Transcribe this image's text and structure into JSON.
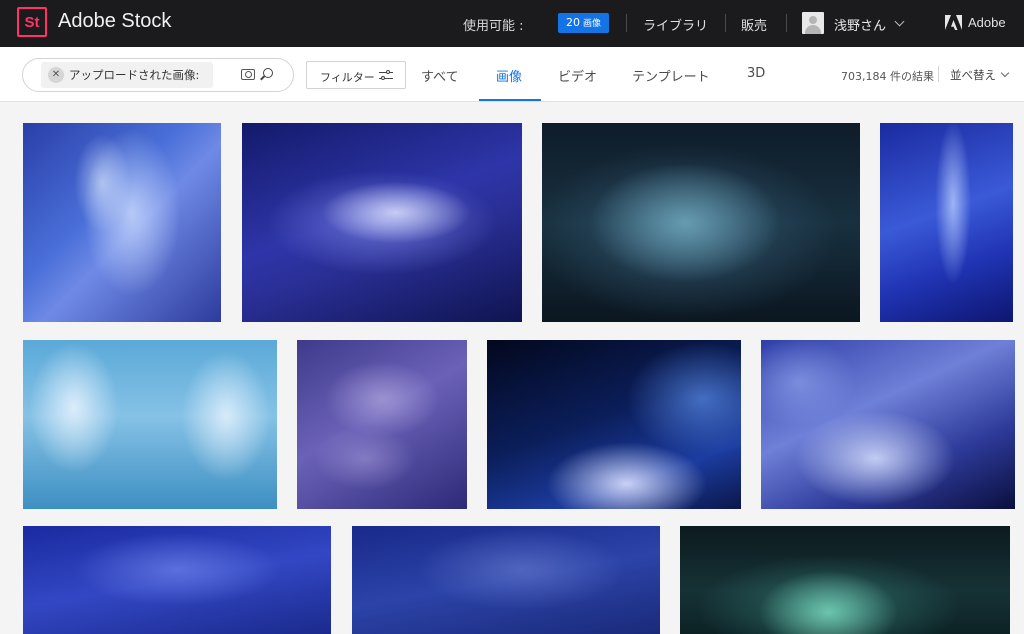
{
  "app": {
    "logo_text": "St",
    "brand": "Adobe Stock"
  },
  "topbar": {
    "available_label": "使用可能 :",
    "credits_count": "20",
    "credits_unit": "画像",
    "library": "ライブラリ",
    "sell": "販売",
    "user_name": "浅野さん",
    "adobe": "Adobe"
  },
  "search": {
    "chip_text": "アップロードされた画像:",
    "filter_label": "フィルター"
  },
  "tabs": [
    {
      "label": "すべて"
    },
    {
      "label": "画像"
    },
    {
      "label": "ビデオ"
    },
    {
      "label": "テンプレート"
    },
    {
      "label": "3D"
    }
  ],
  "active_tab": "画像",
  "results": {
    "count_text": "703,184 件の結果",
    "sort_label": "並べ替え"
  },
  "colors": {
    "accent": "#1473e6",
    "logo": "#ff3366",
    "topbar_bg": "#1b1b1d"
  }
}
